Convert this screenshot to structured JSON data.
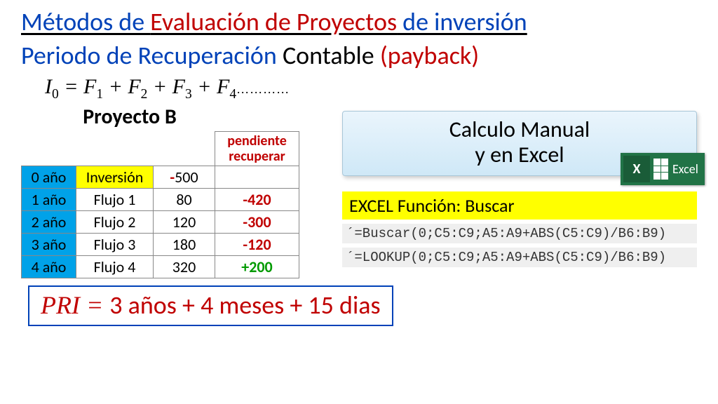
{
  "title": {
    "p1": "Métodos de ",
    "p2": "Evaluación de Proyectos",
    "p3": " de inversión"
  },
  "subtitle": {
    "p1": "Periodo de Recuperación ",
    "p2": "Contable ",
    "p3": "(payback)"
  },
  "formula": {
    "lhs_base": "I",
    "lhs_sub": "0",
    "eq": " = ",
    "t1b": "F",
    "t1s": "1",
    "plus": " + ",
    "t2b": "F",
    "t2s": "2",
    "t3b": "F",
    "t3s": "3",
    "t4b": "F",
    "t4s": "4",
    "dots": "…………"
  },
  "project": {
    "name": "Proyecto B"
  },
  "headers": {
    "pending": "pendiente\nrecuperar"
  },
  "rows": [
    {
      "year": "0 año",
      "label": "Inversión",
      "amount_sign": "-",
      "amount_abs": "500",
      "pending": ""
    },
    {
      "year": "1 año",
      "label": "Flujo 1",
      "amount_sign": "",
      "amount_abs": "80",
      "pending": "-420"
    },
    {
      "year": "2 año",
      "label": "Flujo 2",
      "amount_sign": "",
      "amount_abs": "120",
      "pending": "-300"
    },
    {
      "year": "3 año",
      "label": "Flujo 3",
      "amount_sign": "",
      "amount_abs": "180",
      "pending": "-120"
    },
    {
      "year": "4 año",
      "label": "Flujo 4",
      "amount_sign": "",
      "amount_abs": "320",
      "pending": "+200"
    }
  ],
  "manual": {
    "l1": "Calculo Manual",
    "l2": "y en Excel"
  },
  "excel_logo": {
    "x": "X",
    "label": "Excel"
  },
  "func": {
    "title": "EXCEL Función: Buscar"
  },
  "code1": "´=Buscar(0;C5:C9;A5:A9+ABS(C5:C9)/B6:B9)",
  "code2": "´=LOOKUP(0;C5:C9;A5:A9+ABS(C5:C9)/B6:B9)",
  "pri": {
    "lhs": "PRI",
    "eq": " = ",
    "rhs": "3 años + 4 meses + 15 dias"
  }
}
